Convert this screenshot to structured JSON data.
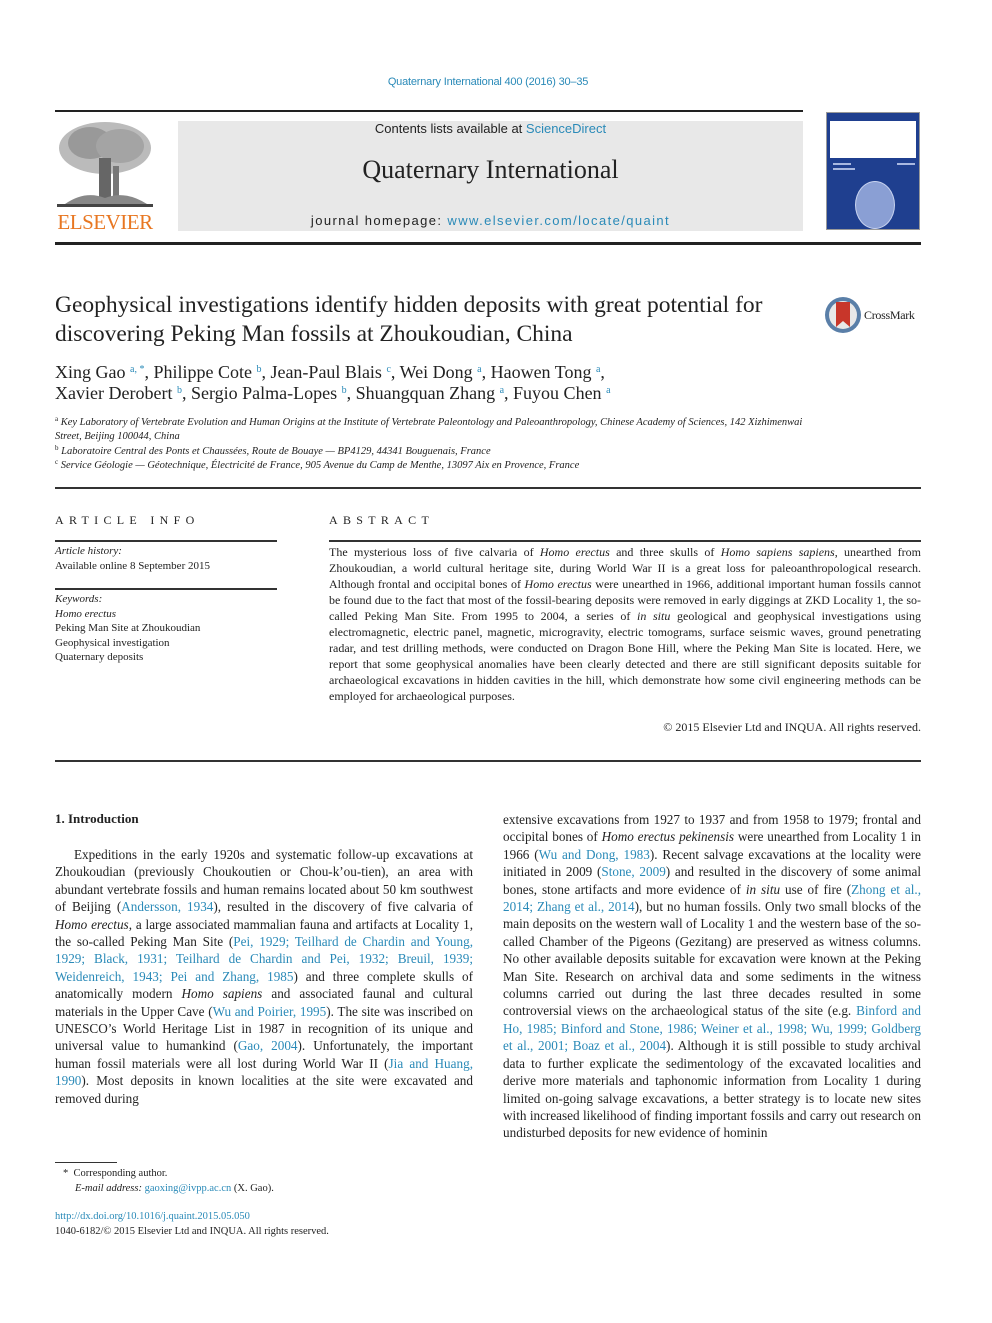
{
  "header": {
    "journal_ref": "Quaternary International 400 (2016) 30–35",
    "contents_prefix": "Contents lists available at ",
    "contents_link": "ScienceDirect",
    "journal_name": "Quaternary International",
    "homepage_prefix": "journal homepage: ",
    "homepage_link": "www.elsevier.com/locate/quaint",
    "publisher_logo_text": "ELSEVIER",
    "crossmark_label": "CrossMark"
  },
  "article": {
    "title": "Geophysical investigations identify hidden deposits with great potential for discovering Peking Man fossils at Zhoukoudian, China",
    "authors": [
      {
        "name": "Xing Gao",
        "aff": "a, *",
        "sep": ", "
      },
      {
        "name": "Philippe Cote",
        "aff": "b",
        "sep": ", "
      },
      {
        "name": "Jean-Paul Blais",
        "aff": "c",
        "sep": ", "
      },
      {
        "name": "Wei Dong",
        "aff": "a",
        "sep": ", "
      },
      {
        "name": "Haowen Tong",
        "aff": "a",
        "sep": ","
      },
      {
        "name": "Xavier Derobert",
        "aff": "b",
        "sep": ", "
      },
      {
        "name": "Sergio Palma-Lopes",
        "aff": "b",
        "sep": ", "
      },
      {
        "name": "Shuangquan Zhang",
        "aff": "a",
        "sep": ", "
      },
      {
        "name": "Fuyou Chen",
        "aff": "a",
        "sep": ""
      }
    ],
    "affiliations": [
      {
        "key": "a",
        "text": "Key Laboratory of Vertebrate Evolution and Human Origins at the Institute of Vertebrate Paleontology and Paleoanthropology, Chinese Academy of Sciences, 142 Xizhimenwai Street, Beijing 100044, China"
      },
      {
        "key": "b",
        "text": "Laboratoire Central des Ponts et Chaussées, Route de Bouaye — BP4129, 44341 Bouguenais, France"
      },
      {
        "key": "c",
        "text": "Service Géologie — Géotechnique, Électricité de France, 905 Avenue du Camp de Menthe, 13097 Aix en Provence, France"
      }
    ]
  },
  "article_info": {
    "heading": "ARTICLE INFO",
    "history_label": "Article history:",
    "history_value": "Available online 8 September 2015",
    "keywords_label": "Keywords:",
    "keywords": [
      "Homo erectus",
      "Peking Man Site at Zhoukoudian",
      "Geophysical investigation",
      "Quaternary deposits"
    ]
  },
  "abstract": {
    "heading": "ABSTRACT",
    "segments": [
      {
        "t": "The mysterious loss of five calvaria of "
      },
      {
        "t": "Homo erectus",
        "i": true
      },
      {
        "t": " and three skulls of "
      },
      {
        "t": "Homo sapiens sapiens",
        "i": true
      },
      {
        "t": ", unearthed from Zhoukoudian, a world cultural heritage site, during World War II is a great loss for paleoanthro­pological research. Although frontal and occipital bones of "
      },
      {
        "t": "Homo erectus",
        "i": true
      },
      {
        "t": " were unearthed in 1966, additional important human fossils cannot be found due to the fact that most of the fossil-bearing deposits were removed in early diggings at ZKD Locality 1, the so-called Peking Man Site. From 1995 to 2004, a series of "
      },
      {
        "t": "in situ",
        "i": true
      },
      {
        "t": " geological and geophysical investigations using electromagnetic, electric panel, magnetic, microgravity, electric tomograms, surface seismic waves, ground penetrating radar, and test drilling methods, were conducted on Dragon Bone Hill, where the Peking Man Site is located. Here, we report that some geophysical anomalies have been clearly detected and there are still significant deposits suitable for archaeological excavations in hidden cavities in the hill, which demonstrate how some civil engineering methods can be employed for archaeological purposes."
      }
    ],
    "copyright": "© 2015 Elsevier Ltd and INQUA. All rights reserved."
  },
  "body": {
    "section_heading": "1.  Introduction",
    "left_column": [
      {
        "t": "Expeditions in the early 1920s and systematic follow-up exca­vations at Zhoukoudian (previously Choukoutien or Chou-k’ou-tien), an area with abundant vertebrate fossils and human remains located about 50 km southwest of Beijing ("
      },
      {
        "t": "Andersson, 1934",
        "l": true
      },
      {
        "t": "), resulted in the discovery of five calvaria of "
      },
      {
        "t": "Homo erectus",
        "i": true
      },
      {
        "t": ", a large associated mammalian fauna and artifacts at Locality 1, the so-called Peking Man Site ("
      },
      {
        "t": "Pei, 1929; Teilhard de Chardin and Young, 1929; Black, 1931; Teilhard de Chardin and Pei, 1932; Breuil, 1939; Weidenreich, 1943; Pei and Zhang, 1985",
        "l": true
      },
      {
        "t": ") and three complete skulls of anatomically modern "
      },
      {
        "t": "Homo sapiens",
        "i": true
      },
      {
        "t": " and associated faunal and cultural materials in the Upper Cave ("
      },
      {
        "t": "Wu and Poirier, 1995",
        "l": true
      },
      {
        "t": "). The site was inscribed on UNESCO’s World Heritage List in 1987 in recognition of its unique and universal value to humankind ("
      },
      {
        "t": "Gao, 2004",
        "l": true
      },
      {
        "t": "). Unfortunately, the important human fossil materials were all lost during World War II ("
      },
      {
        "t": "Jia and Huang, 1990",
        "l": true
      },
      {
        "t": "). Most deposits in known localities at the site were excavated and removed during"
      }
    ],
    "right_column": [
      {
        "t": "extensive excavations from 1927 to 1937 and from 1958 to 1979; frontal and occipital bones of "
      },
      {
        "t": "Homo erectus pekinensis",
        "i": true
      },
      {
        "t": " were unearthed from Locality 1 in 1966 ("
      },
      {
        "t": "Wu and Dong, 1983",
        "l": true
      },
      {
        "t": "). Recent salvage excavations at the locality were initiated in 2009 ("
      },
      {
        "t": "Stone, 2009",
        "l": true
      },
      {
        "t": ") and resulted in the discovery of some animal bones, stone artifacts and more evidence of "
      },
      {
        "t": "in situ",
        "i": true
      },
      {
        "t": " use of fire ("
      },
      {
        "t": "Zhong et al., 2014; Zhang et al., 2014",
        "l": true
      },
      {
        "t": "), but no human fossils. Only two small blocks of the main deposits on the western wall of Locality 1 and the western base of the so-called Chamber of the Pigeons (Gezitang) are pre­served as witness columns. No other available deposits suitable for excavation were known at the Peking Man Site. Research on archival data and some sediments in the witness columns carried out during the last three decades resulted in some controversial views on the archaeological status of the site (e.g. "
      },
      {
        "t": "Binford and Ho, 1985; Binford and Stone, 1986; Weiner et al., 1998; Wu, 1999; Goldberg et al., 2001; Boaz et al., 2004",
        "l": true
      },
      {
        "t": "). Although it is still possible to study archival data to further explicate the sedimen­tology of the excavated localities and derive more materials and taphonomic information from Locality 1 during limited on-going salvage excavations, a better strategy is to locate new sites with increased likelihood of finding important fossils and carry out research on undisturbed deposits for new evidence of hominin"
      }
    ]
  },
  "footer": {
    "corresponding_mark": "*",
    "corresponding_label": "Corresponding author.",
    "email_label": "E-mail address:",
    "email": "gaoxing@ivpp.ac.cn",
    "email_suffix": " (X. Gao).",
    "doi": "http://dx.doi.org/10.1016/j.quaint.2015.05.050",
    "issn_line": "1040-6182/© 2015 Elsevier Ltd and INQUA. All rights reserved."
  },
  "colors": {
    "link": "#2a8ab8",
    "elsevier_orange": "#e87722",
    "masthead_gray": "#e8e8e8",
    "cover_blue": "#1f3f8f"
  }
}
